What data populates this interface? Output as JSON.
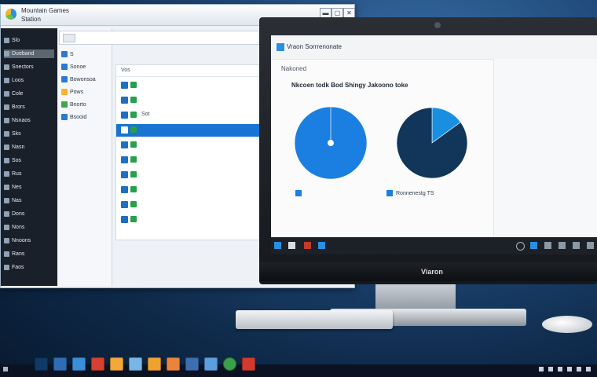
{
  "explorer": {
    "title": "Mountain Games",
    "subtitle": "Station",
    "address": "",
    "breadcrumb": "",
    "sidebar": [
      {
        "label": "Slo",
        "icon": "folder-icon"
      },
      {
        "label": "Dueband",
        "icon": "folder-icon"
      },
      {
        "label": "Snectors",
        "icon": "folder-icon"
      },
      {
        "label": "Loos",
        "icon": "folder-icon"
      },
      {
        "label": "Cole",
        "icon": "folder-icon"
      },
      {
        "label": "Brors",
        "icon": "folder-icon"
      },
      {
        "label": "Nsnaos",
        "icon": "folder-icon"
      },
      {
        "label": "Sks",
        "icon": "folder-icon"
      },
      {
        "label": "Nasn",
        "icon": "folder-icon"
      },
      {
        "label": "Sos",
        "icon": "folder-icon"
      },
      {
        "label": "Rus",
        "icon": "folder-icon"
      },
      {
        "label": "Nes",
        "icon": "folder-icon"
      },
      {
        "label": "Nas",
        "icon": "folder-icon"
      },
      {
        "label": "Dons",
        "icon": "folder-icon"
      },
      {
        "label": "Nons",
        "icon": "folder-icon"
      },
      {
        "label": "Nnoons",
        "icon": "folder-icon"
      },
      {
        "label": "Rans",
        "icon": "folder-icon"
      },
      {
        "label": "Faos",
        "icon": "folder-icon"
      }
    ],
    "pane2": [
      {
        "label": "S",
        "color": "#2c7ad0"
      },
      {
        "label": "Sonoe",
        "color": "#2c7ad0"
      },
      {
        "label": "Bowonsoa",
        "color": "#2c7ad0"
      },
      {
        "label": "Pows",
        "color": "#ffb02e"
      },
      {
        "label": "Bnorto",
        "color": "#3ea84a"
      },
      {
        "label": "Bsooid",
        "color": "#2c7ad0"
      }
    ],
    "list_header": "Vos",
    "rows": [
      {
        "label": "",
        "selected": false
      },
      {
        "label": "",
        "selected": false
      },
      {
        "label": "Sot",
        "selected": false
      },
      {
        "label": "",
        "selected": true
      },
      {
        "label": "",
        "selected": false
      },
      {
        "label": "",
        "selected": false
      },
      {
        "label": "",
        "selected": false
      },
      {
        "label": "",
        "selected": false
      },
      {
        "label": "",
        "selected": false
      },
      {
        "label": "",
        "selected": false
      }
    ]
  },
  "monitor": {
    "window_title": "Vraon Sorrrenonate",
    "back_label": "Nakoned",
    "heading": "Nkcoen todk Bod Shingy Jakoono toke",
    "brand": "Viaron",
    "legend": [
      "",
      "Ronnenestg TS"
    ],
    "colors": {
      "primary": "#1a7fe0",
      "dark": "#12355a"
    }
  },
  "chart_data": [
    {
      "type": "pie",
      "values": [
        100
      ],
      "colors": [
        "#1a7fe0"
      ]
    },
    {
      "type": "pie",
      "values": [
        15,
        85
      ],
      "colors": [
        "#1a8fe0",
        "#12355a"
      ]
    }
  ],
  "taskbar": {
    "icons": [
      "start-icon",
      "monitor-icon",
      "globe-icon",
      "media-icon",
      "folder-icon",
      "explorer-icon",
      "settings-icon",
      "mail-icon",
      "image-icon",
      "app-icon",
      "record-icon",
      "tool-icon"
    ]
  }
}
